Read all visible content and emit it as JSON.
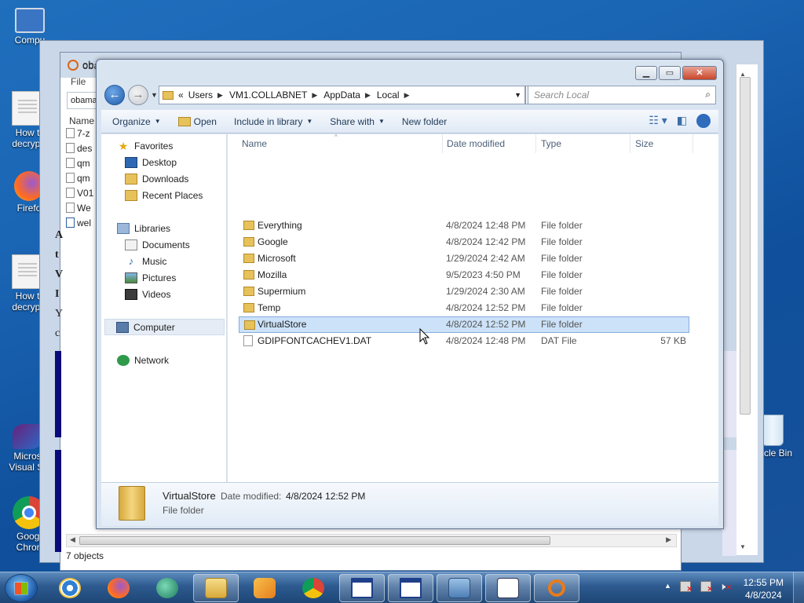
{
  "desktop": {
    "icons": [
      {
        "label": "Compu"
      },
      {
        "label_line1": "How t",
        "label_line2": "decrypt"
      },
      {
        "label": "Firefo"
      },
      {
        "label_line1": "How t",
        "label_line2": "decrypt"
      },
      {
        "label_line1": "Micros",
        "label_line2": "Visual St"
      },
      {
        "label_line1": "Googl",
        "label_line2": "Chron"
      }
    ],
    "recycle_label": "cle Bin"
  },
  "back_window": {
    "title": "oba",
    "title_behind": "ob",
    "menu_file": "File",
    "address_text": "obama",
    "name_header": "Name",
    "files": [
      "7-z",
      "des",
      "qm",
      "qm",
      "V01",
      "We",
      "wel"
    ],
    "side_letters": [
      "A",
      "t",
      "V",
      "I",
      "Y",
      "c"
    ],
    "status": "7 objects"
  },
  "explorer": {
    "breadcrumb": [
      "Users",
      "VM1.COLLABNET",
      "AppData",
      "Local"
    ],
    "breadcrumb_prefix": "«",
    "search_placeholder": "Search Local",
    "toolbar": {
      "organize": "Organize",
      "open": "Open",
      "include_in_library": "Include in library",
      "share_with": "Share with",
      "new_folder": "New folder"
    },
    "nav": {
      "favorites": "Favorites",
      "desktop": "Desktop",
      "downloads": "Downloads",
      "recent_places": "Recent Places",
      "libraries": "Libraries",
      "documents": "Documents",
      "music": "Music",
      "pictures": "Pictures",
      "videos": "Videos",
      "computer": "Computer",
      "network": "Network"
    },
    "columns": {
      "name": "Name",
      "date": "Date modified",
      "type": "Type",
      "size": "Size"
    },
    "rows": [
      {
        "name": "Everything",
        "date": "4/8/2024 12:48 PM",
        "type": "File folder",
        "size": ""
      },
      {
        "name": "Google",
        "date": "4/8/2024 12:42 PM",
        "type": "File folder",
        "size": ""
      },
      {
        "name": "Microsoft",
        "date": "1/29/2024 2:42 AM",
        "type": "File folder",
        "size": ""
      },
      {
        "name": "Mozilla",
        "date": "9/5/2023 4:50 PM",
        "type": "File folder",
        "size": ""
      },
      {
        "name": "Supermium",
        "date": "1/29/2024 2:30 AM",
        "type": "File folder",
        "size": ""
      },
      {
        "name": "Temp",
        "date": "4/8/2024 12:52 PM",
        "type": "File folder",
        "size": ""
      },
      {
        "name": "VirtualStore",
        "date": "4/8/2024 12:52 PM",
        "type": "File folder",
        "size": ""
      },
      {
        "name": "GDIPFONTCACHEV1.DAT",
        "date": "4/8/2024 12:48 PM",
        "type": "DAT File",
        "size": "57 KB"
      }
    ],
    "selected_row": 6,
    "details": {
      "name": "VirtualStore",
      "date_label": "Date modified:",
      "date": "4/8/2024 12:52 PM",
      "type": "File folder"
    }
  },
  "taskbar": {
    "time": "12:55 PM",
    "date": "4/8/2024"
  }
}
